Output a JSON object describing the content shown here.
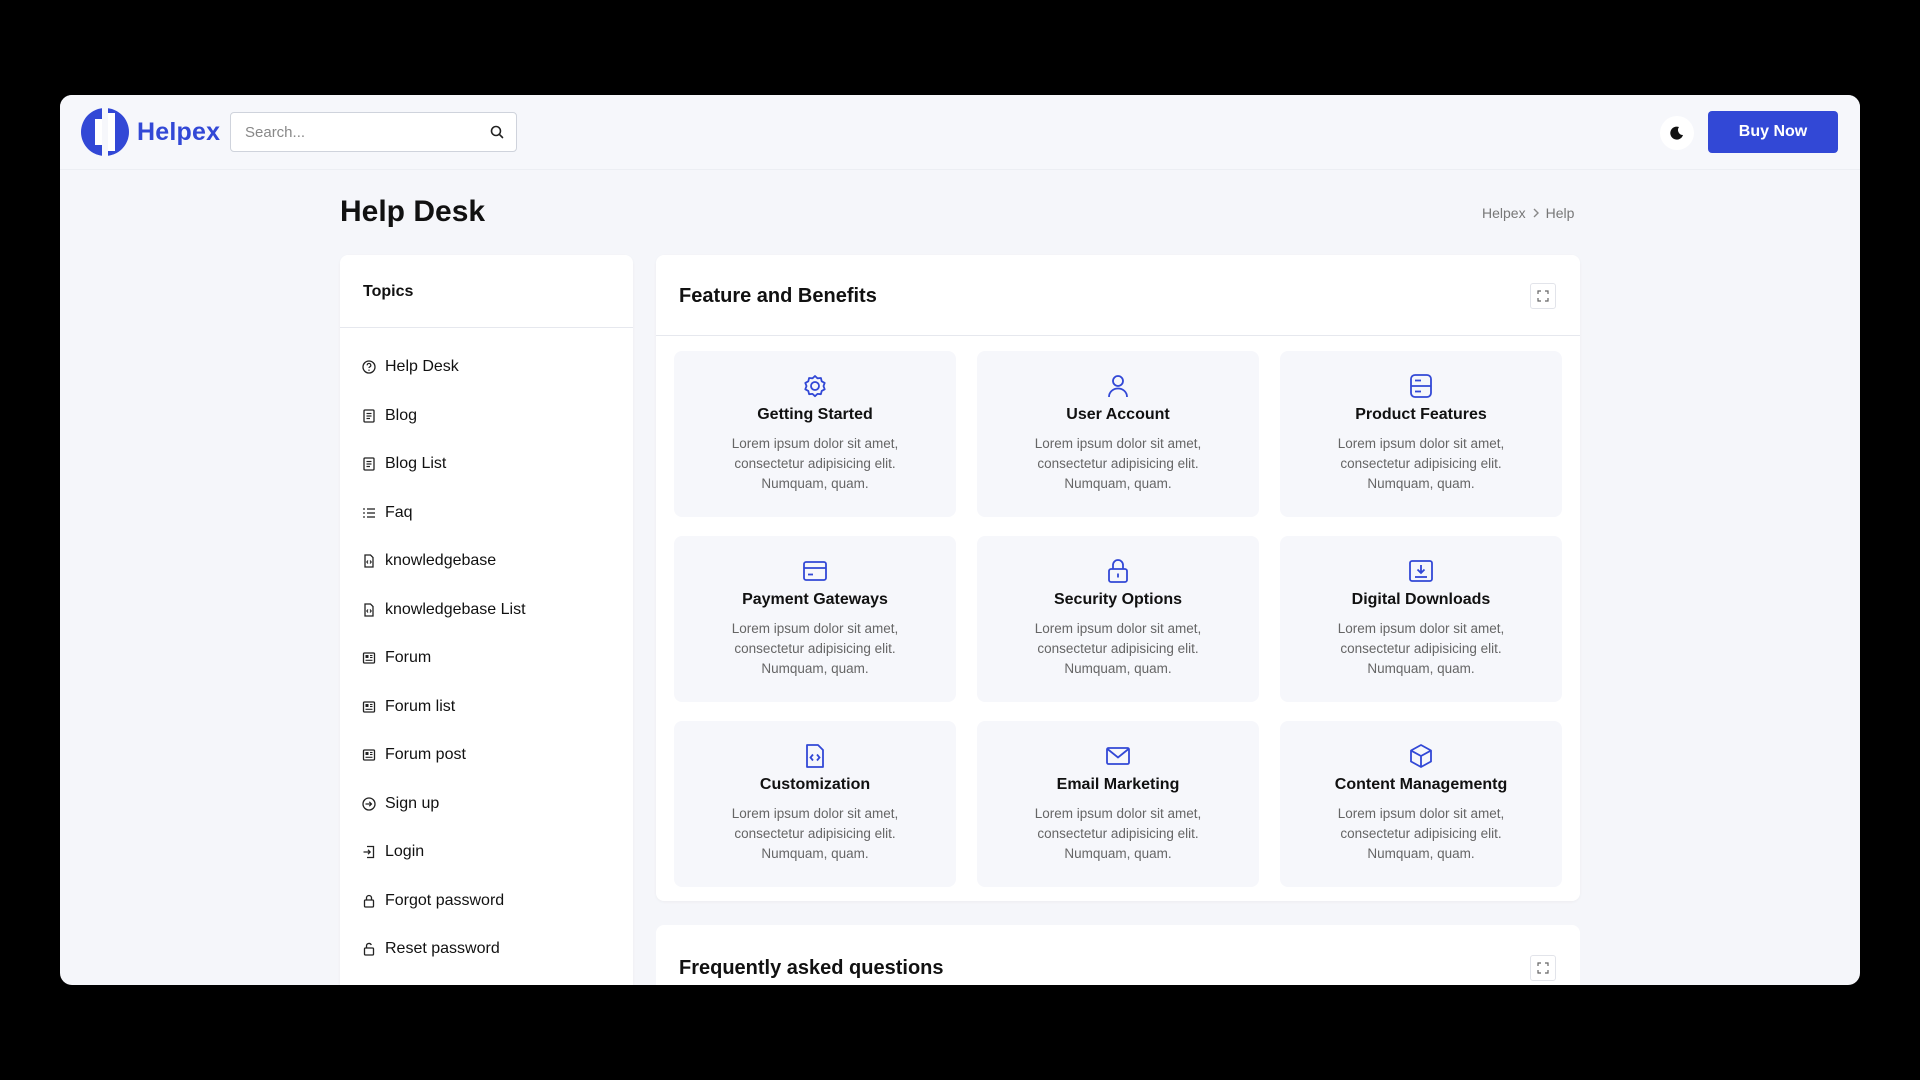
{
  "brand": {
    "name": "Helpex",
    "color": "#3248d6"
  },
  "search": {
    "placeholder": "Search..."
  },
  "header": {
    "buy_label": "Buy Now"
  },
  "page": {
    "title": "Help Desk"
  },
  "breadcrumb": {
    "items": [
      "Helpex",
      "Help"
    ]
  },
  "sidebar": {
    "title": "Topics",
    "items": [
      {
        "label": "Help Desk",
        "icon": "help-circle-icon"
      },
      {
        "label": "Blog",
        "icon": "document-icon"
      },
      {
        "label": "Blog List",
        "icon": "document-icon"
      },
      {
        "label": "Faq",
        "icon": "list-icon"
      },
      {
        "label": "knowledgebase",
        "icon": "file-code-icon"
      },
      {
        "label": "knowledgebase List",
        "icon": "file-code-icon"
      },
      {
        "label": "Forum",
        "icon": "newspaper-icon"
      },
      {
        "label": "Forum list",
        "icon": "newspaper-icon"
      },
      {
        "label": "Forum post",
        "icon": "newspaper-icon"
      },
      {
        "label": "Sign up",
        "icon": "sign-in-icon"
      },
      {
        "label": "Login",
        "icon": "login-icon"
      },
      {
        "label": "Forgot password",
        "icon": "lock-icon"
      },
      {
        "label": "Reset password",
        "icon": "unlock-icon"
      }
    ]
  },
  "features": {
    "title": "Feature and Benefits",
    "tiles": [
      {
        "title": "Getting Started",
        "desc": "Lorem ipsum dolor sit amet, consectetur adipisicing elit. Numquam, quam.",
        "icon": "gear-icon"
      },
      {
        "title": "User Account",
        "desc": "Lorem ipsum dolor sit amet, consectetur adipisicing elit. Numquam, quam.",
        "icon": "user-icon"
      },
      {
        "title": "Product Features",
        "desc": "Lorem ipsum dolor sit amet, consectetur adipisicing elit. Numquam, quam.",
        "icon": "server-icon"
      },
      {
        "title": "Payment Gateways",
        "desc": "Lorem ipsum dolor sit amet, consectetur adipisicing elit. Numquam, quam.",
        "icon": "credit-card-icon"
      },
      {
        "title": "Security Options",
        "desc": "Lorem ipsum dolor sit amet, consectetur adipisicing elit. Numquam, quam.",
        "icon": "lock-icon"
      },
      {
        "title": "Digital Downloads",
        "desc": "Lorem ipsum dolor sit amet, consectetur adipisicing elit. Numquam, quam.",
        "icon": "download-box-icon"
      },
      {
        "title": "Customization",
        "desc": "Lorem ipsum dolor sit amet, consectetur adipisicing elit. Numquam, quam.",
        "icon": "file-code-icon"
      },
      {
        "title": "Email Marketing",
        "desc": "Lorem ipsum dolor sit amet, consectetur adipisicing elit. Numquam, quam.",
        "icon": "mail-icon"
      },
      {
        "title": "Content Managementg",
        "desc": "Lorem ipsum dolor sit amet, consectetur adipisicing elit. Numquam, quam.",
        "icon": "cube-icon"
      }
    ]
  },
  "faq": {
    "title": "Frequently asked questions"
  }
}
